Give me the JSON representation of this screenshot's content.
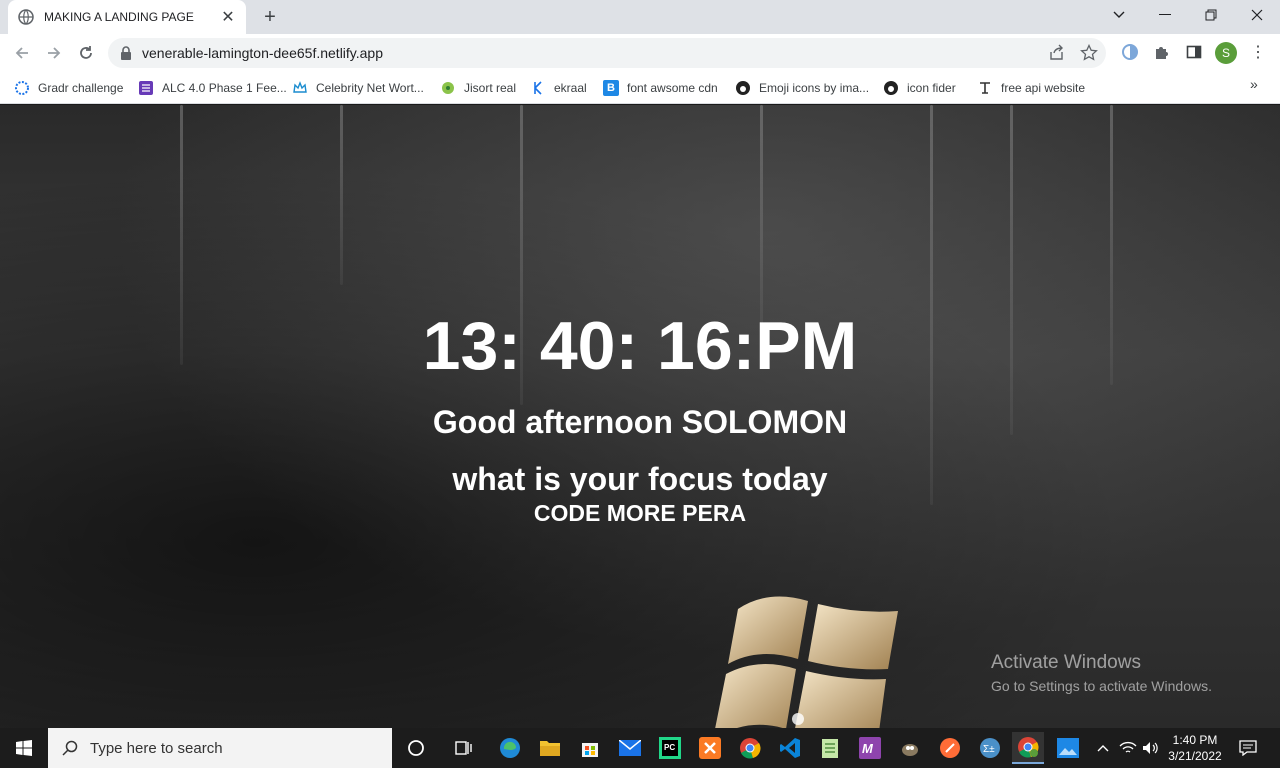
{
  "browser": {
    "tab_title": "MAKING A LANDING PAGE",
    "url": "venerable-lamington-dee65f.netlify.app",
    "profile_initial": "S"
  },
  "bookmarks": [
    {
      "label": "Gradr challenge",
      "icon": "gear-icon"
    },
    {
      "label": "ALC 4.0 Phase 1 Fee...",
      "icon": "form-icon"
    },
    {
      "label": "Celebrity Net Wort...",
      "icon": "crown-icon"
    },
    {
      "label": "Jisort real",
      "icon": "circle-icon"
    },
    {
      "label": "ekraal",
      "icon": "ekraal-icon"
    },
    {
      "label": "font awsome cdn",
      "icon": "bootstrap-icon"
    },
    {
      "label": "Emoji icons by ima...",
      "icon": "github-icon"
    },
    {
      "label": "icon fider",
      "icon": "github-icon"
    },
    {
      "label": "free api website",
      "icon": "api-icon"
    }
  ],
  "landing": {
    "clock": "13: 40: 16:PM",
    "greeting": "Good afternoon SOLOMON",
    "question": "what is your focus today",
    "focus": "CODE MORE PERA"
  },
  "watermark": {
    "title": "Activate Windows",
    "subtitle": "Go to Settings to activate Windows."
  },
  "taskbar": {
    "search_placeholder": "Type here to search",
    "time": "1:40 PM",
    "date": "3/21/2022"
  },
  "colors": {
    "taskbar_bg": "#1c1c1c",
    "tab_strip_bg": "#dee1e6",
    "profile_green": "#5a9d3a",
    "text_white": "#ffffff"
  }
}
